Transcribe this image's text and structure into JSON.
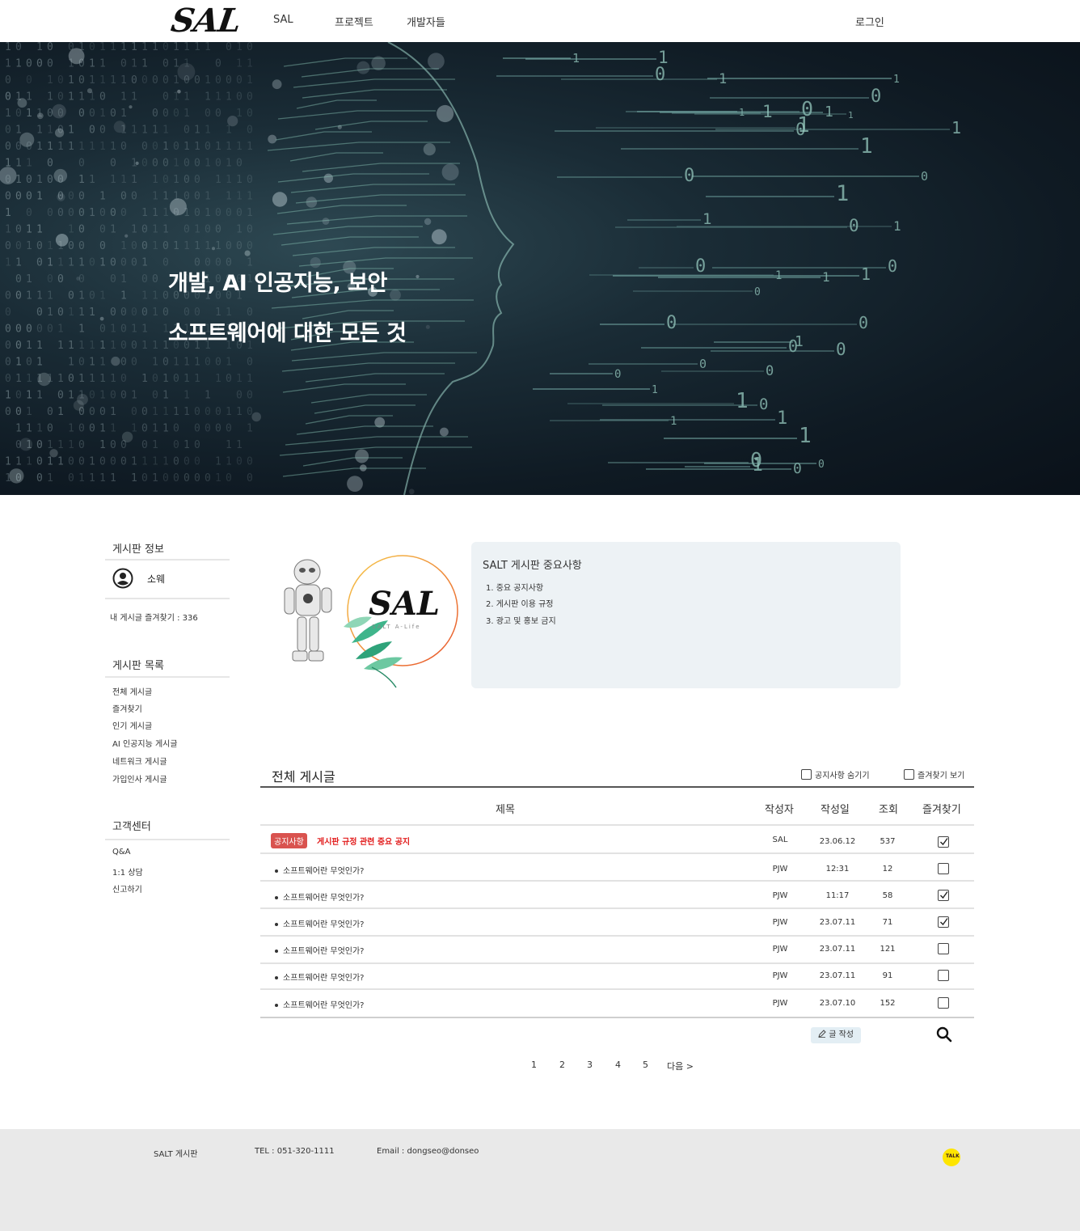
{
  "header": {
    "logo": "SAL",
    "nav": [
      "SAL",
      "프로젝트",
      "개발자들"
    ],
    "login": "로그인"
  },
  "hero": {
    "line1": "개발, AI 인공지능, 보안",
    "line2": "소프트웨어에 대한 모든 것"
  },
  "sidebar": {
    "info_title": "게시판 정보",
    "username": "소웨",
    "stat": "내 게시글 즐겨찾기 : 336",
    "list_title": "게시판 목록",
    "list": [
      "전체 게시글",
      "즐겨찾기",
      "인기 게시글",
      "AI 인공지능 게시글",
      "네트워크 게시글",
      "가입인사 게시글"
    ],
    "support_title": "고객센터",
    "support": [
      "Q&A",
      "1:1 상담",
      "신고하기"
    ]
  },
  "illustration": {
    "logo_text": "SAL",
    "tagline": "SALT A-Life"
  },
  "notice_panel": {
    "title": "SALT 게시판 중요사항",
    "items": [
      "1. 중요 공지사항",
      "2. 게시판 이용 규정",
      "3. 광고 및 홍보 금지"
    ]
  },
  "board": {
    "title": "전체 게시글",
    "option_hide_notice": "공지사항 숨기기",
    "option_show_fav": "즐겨찾기 보기",
    "columns": [
      "제목",
      "작성자",
      "작성일",
      "조회",
      "즐겨찾기"
    ],
    "notice_row": {
      "badge": "공지사항",
      "title": "게시판 규정 관련 중요 공지",
      "author": "SAL",
      "date": "23.06.12",
      "views": "537",
      "fav": true
    },
    "rows": [
      {
        "title": "소프트웨어란 무엇인가?",
        "author": "PJW",
        "date": "12:31",
        "views": "12",
        "fav": false
      },
      {
        "title": "소프트웨어란 무엇인가?",
        "author": "PJW",
        "date": "11:17",
        "views": "58",
        "fav": true
      },
      {
        "title": "소프트웨어란 무엇인가?",
        "author": "PJW",
        "date": "23.07.11",
        "views": "71",
        "fav": true
      },
      {
        "title": "소프트웨어란 무엇인가?",
        "author": "PJW",
        "date": "23.07.11",
        "views": "121",
        "fav": false
      },
      {
        "title": "소프트웨어란 무엇인가?",
        "author": "PJW",
        "date": "23.07.11",
        "views": "91",
        "fav": false
      },
      {
        "title": "소프트웨어란 무엇인가?",
        "author": "PJW",
        "date": "23.07.10",
        "views": "152",
        "fav": false
      }
    ],
    "write_label": "글 작성",
    "pages": [
      "1",
      "2",
      "3",
      "4",
      "5",
      "다음 >"
    ]
  },
  "footer": {
    "name": "SALT 게시판",
    "tel": "TEL : 051-320-1111",
    "email": "Email : dongseo@donseo",
    "kakao_label": "TALK"
  },
  "colors": {
    "notice_red": "#e21b1b",
    "badge_red": "#d9534f",
    "panel_bg": "#edf2f5",
    "footer_bg": "#e9e9e9",
    "kakao_yellow": "#fee500"
  }
}
